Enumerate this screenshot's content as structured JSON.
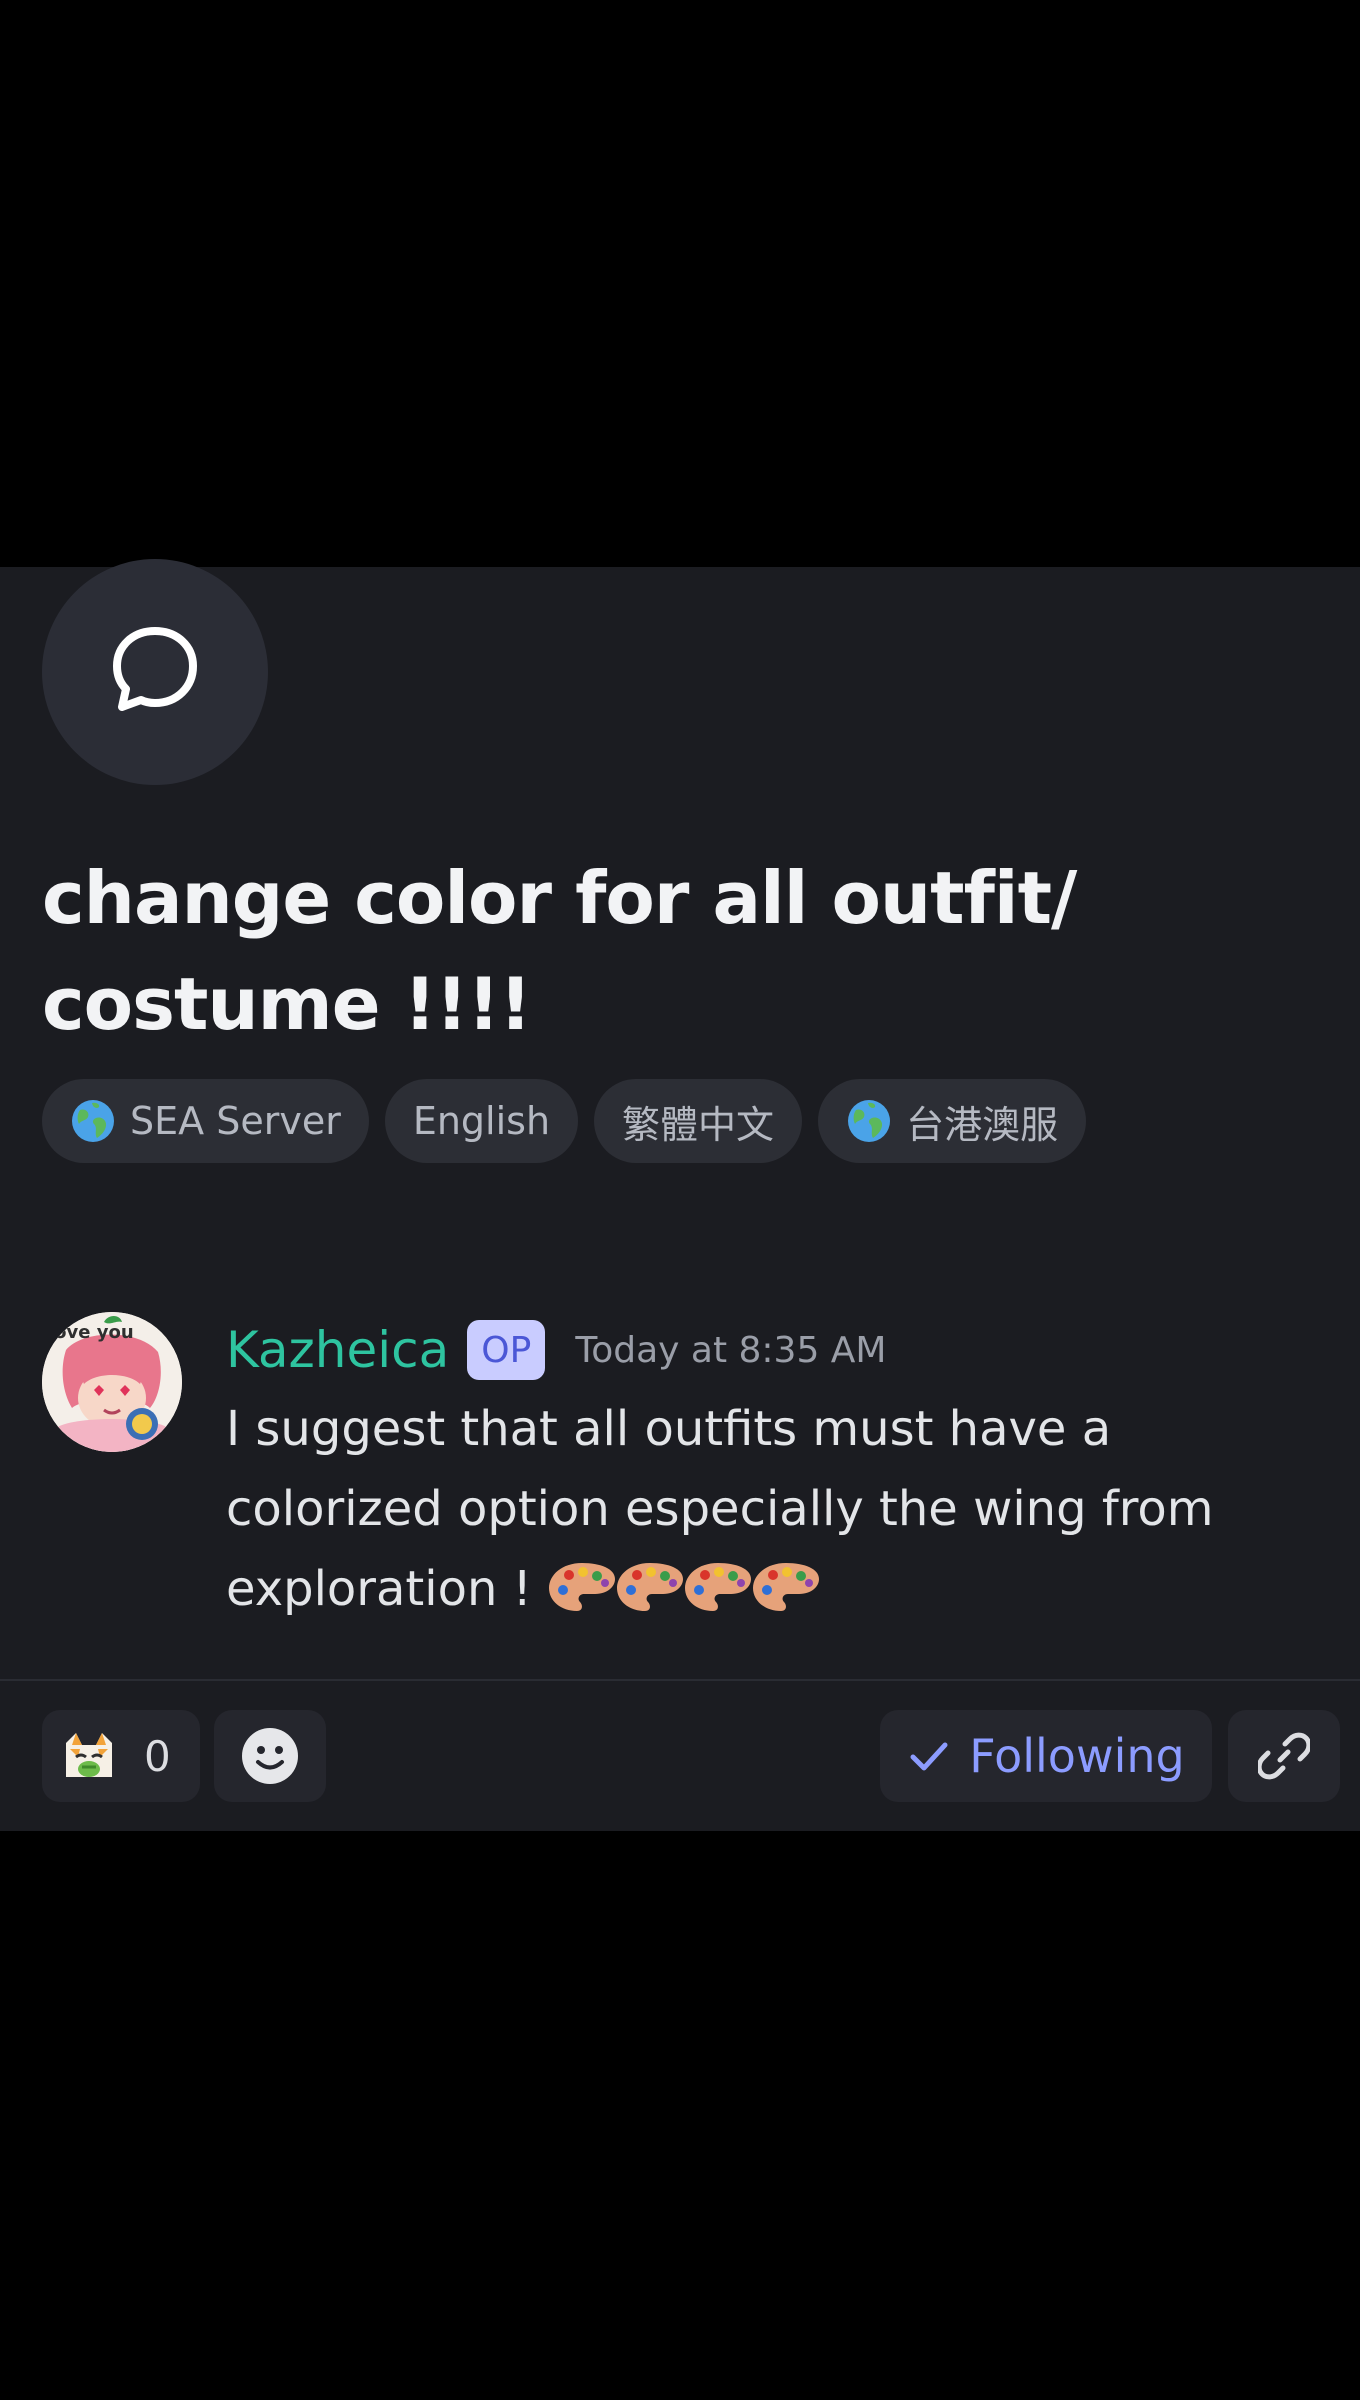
{
  "thread": {
    "icon": "chat-bubble-icon",
    "title": "change color for all outfit/ costume !!!!",
    "tags": [
      {
        "label": "SEA Server",
        "icon": "globe-icon"
      },
      {
        "label": "English",
        "icon": ""
      },
      {
        "label": "繁體中文",
        "icon": ""
      },
      {
        "label": "台港澳服",
        "icon": "globe-icon"
      }
    ]
  },
  "message": {
    "author": "Kazheica",
    "author_color": "#2ec4a0",
    "badge": "OP",
    "timestamp": "Today at 8:35 AM",
    "text": "I suggest that all outfits must have a colorized option especially the wing from exploration !",
    "emoji": [
      "artist-palette",
      "artist-palette",
      "artist-palette",
      "artist-palette"
    ],
    "avatar_caption": "love you"
  },
  "actions": {
    "reaction_count": "0",
    "following_label": "Following",
    "accent_color": "#8c9cff"
  }
}
